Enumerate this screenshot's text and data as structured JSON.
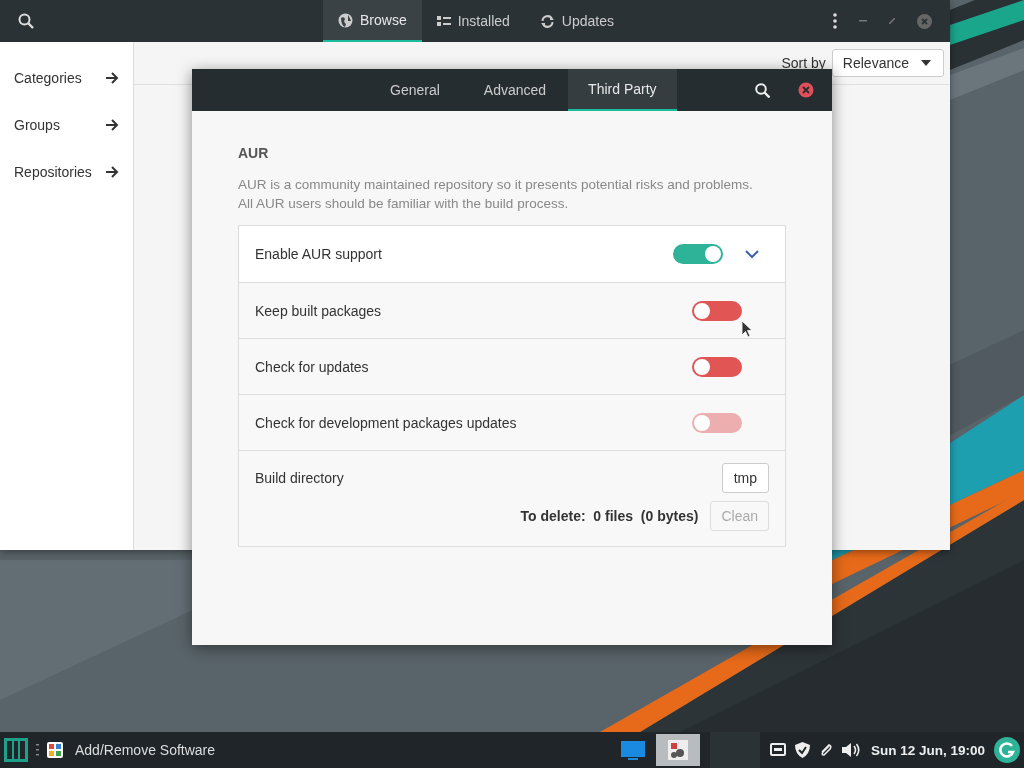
{
  "main_window": {
    "header_tabs": [
      {
        "label": "Browse",
        "selected": true
      },
      {
        "label": "Installed",
        "selected": false
      },
      {
        "label": "Updates",
        "selected": false
      }
    ],
    "sidebar": {
      "items": [
        {
          "label": "Categories"
        },
        {
          "label": "Groups"
        },
        {
          "label": "Repositories"
        }
      ]
    },
    "sort": {
      "label": "Sort by",
      "value": "Relevance"
    }
  },
  "dialog": {
    "tabs": [
      {
        "label": "General",
        "selected": false
      },
      {
        "label": "Advanced",
        "selected": false
      },
      {
        "label": "Third Party",
        "selected": true
      }
    ],
    "section_title": "AUR",
    "description_lines": [
      "AUR is a community maintained repository so it presents potential risks and problems.",
      "All AUR users should be familiar with the build process."
    ],
    "settings": [
      {
        "kind": "toggle",
        "label": "Enable AUR support",
        "on": true,
        "disabled": false,
        "expanded": true
      },
      {
        "kind": "toggle",
        "label": "Keep built packages",
        "on": false,
        "disabled": false
      },
      {
        "kind": "toggle",
        "label": "Check for updates",
        "on": false,
        "disabled": false
      },
      {
        "kind": "toggle",
        "label": "Check for development packages updates",
        "on": false,
        "disabled": true
      },
      {
        "kind": "directory",
        "label": "Build directory",
        "value": "tmp"
      }
    ],
    "delete_summary": {
      "label": "To delete:",
      "files": "0 files",
      "size": "(0 bytes)"
    },
    "clean_button": {
      "label": "Clean",
      "disabled": true
    }
  },
  "taskbar": {
    "app_title": "Add/Remove Software",
    "clock": "Sun 12 Jun, 19:00"
  }
}
